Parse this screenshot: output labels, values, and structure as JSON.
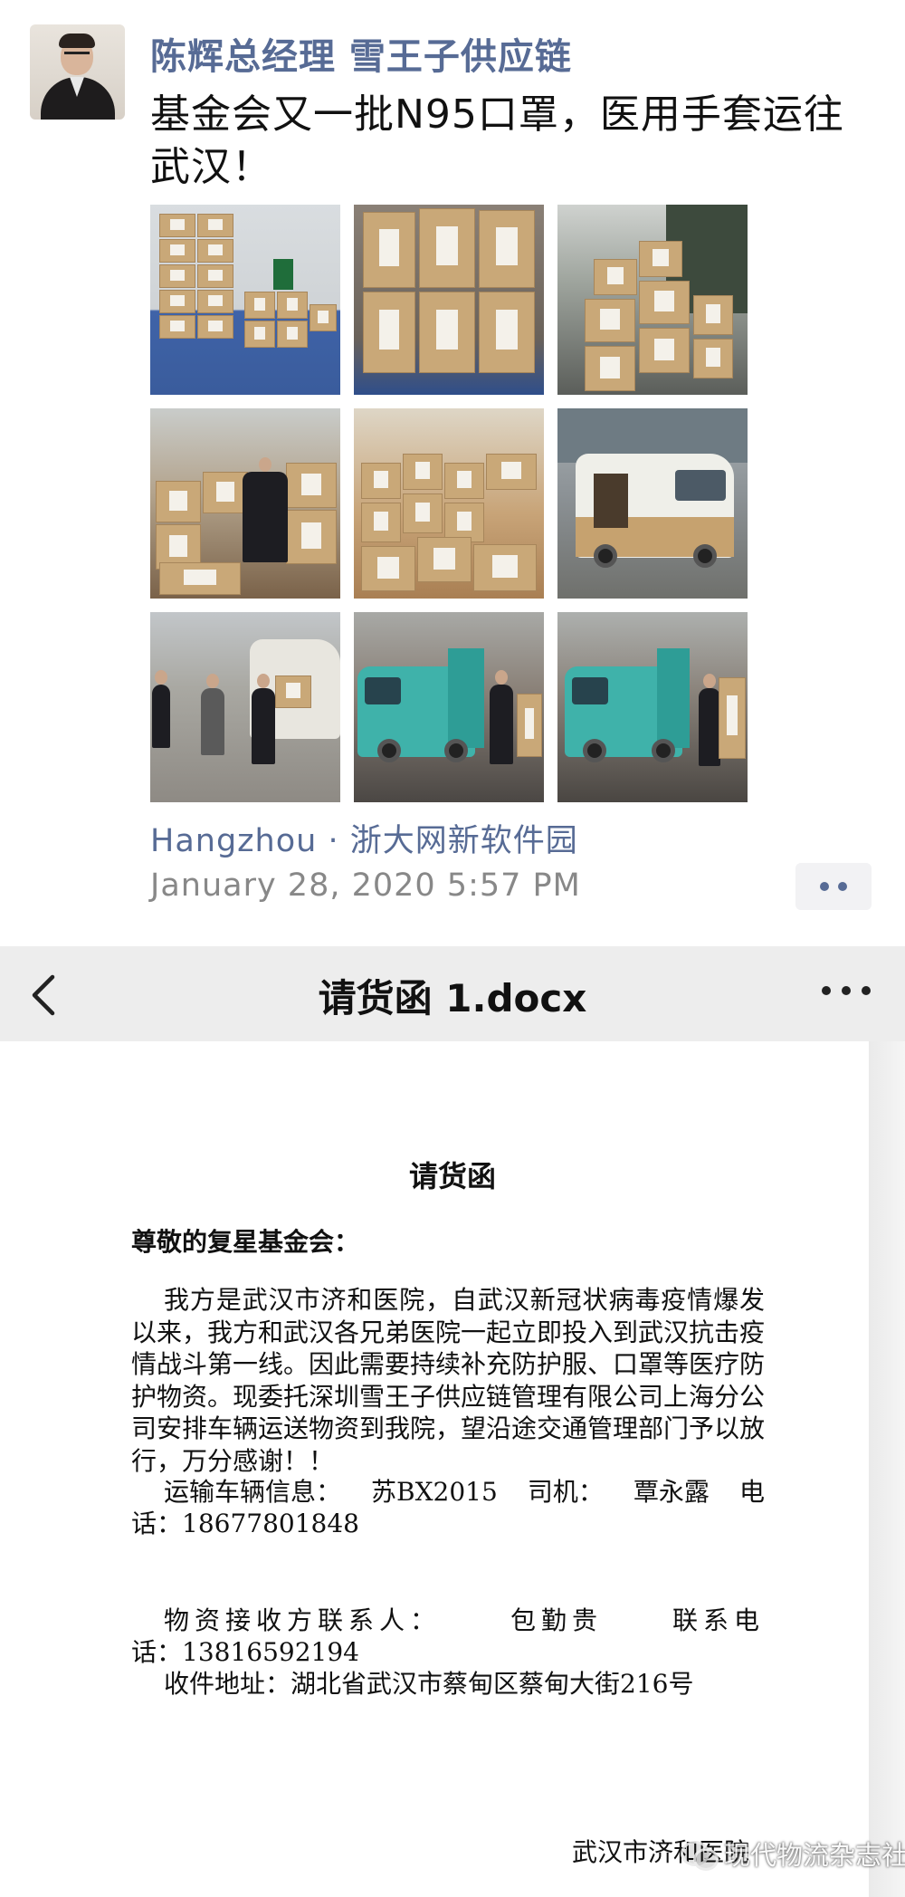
{
  "post": {
    "author": "陈辉总经理 雪王子供应链",
    "text": "基金会又一批N95口罩，医用手套运往武汉！",
    "location": "Hangzhou · 浙大网新软件园",
    "timestamp": "January 28, 2020 5:57 PM",
    "photo_names": [
      "boxes-on-pallet",
      "boxes-with-labels",
      "stacked-cartons",
      "worker-in-warehouse",
      "packed-room",
      "loaded-van",
      "street-unloading",
      "teal-van-loading",
      "teal-van-loading-2"
    ],
    "icons": {
      "avatar": "avatar",
      "more": "more-dots-icon"
    }
  },
  "doc_viewer": {
    "title": "请货函 1.docx",
    "icons": {
      "back": "back-chevron-icon",
      "menu": "more-dots-icon"
    }
  },
  "letter": {
    "title": "请货函",
    "salutation": "尊敬的复星基金会：",
    "body": "我方是武汉市济和医院，自武汉新冠状病毒疫情爆发以来，我方和武汉各兄弟医院一起立即投入到武汉抗击疫情战斗第一线。因此需要持续补充防护服、口罩等医疗防护物资。现委托深圳雪王子供应链管理有限公司上海分公司安排车辆运送物资到我院，望沿途交通管理部门予以放行，万分感谢！！",
    "vehicle": {
      "label": "运输车辆信息：",
      "plate": "苏BX2015",
      "driver_label": "司机：",
      "driver": "覃永露",
      "phone_label_a": "电",
      "phone_label_b": "话：",
      "phone": "18677801848"
    },
    "receiver": {
      "label": "物资接收方联系人：",
      "name": "包勤贵",
      "phone_label_a": "联系电",
      "phone_label_b": "话：",
      "phone": "13816592194"
    },
    "address_label": "收件地址：",
    "address": "湖北省武汉市蔡甸区蔡甸大街216号",
    "signature": "武汉市济和医院"
  },
  "watermark": {
    "text": "现代物流杂志社"
  },
  "colors": {
    "link": "#576b95",
    "header_bg": "#ededed",
    "meta": "#888888"
  }
}
